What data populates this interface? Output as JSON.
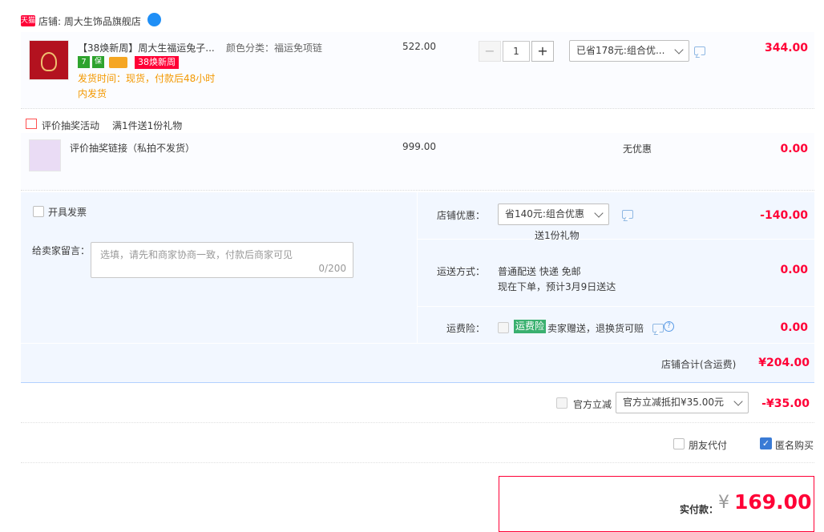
{
  "shop": {
    "badge": "天猫",
    "label": "店铺: 周大生饰品旗舰店",
    "wangwang": "(·)"
  },
  "item1": {
    "title": "【38焕新周】周大生福运兔子...",
    "sku": "颜色分类：福运免项链",
    "price": "522.00",
    "tag1": "7",
    "tag2": "保",
    "promo_badge": "38焕新周",
    "delivery_line1": "发货时间：现货，付款后48小时",
    "delivery_line2": "内发货",
    "quantity": "1",
    "discount_select": "已省178元:组合优...",
    "subtotal": "344.00",
    "minus": "−",
    "plus": "+"
  },
  "activity": {
    "label": "评价抽奖活动",
    "desc": "满1件送1份礼物"
  },
  "item2": {
    "title": "评价抽奖链接（私拍不发货）",
    "price": "999.00",
    "promo": "无优惠",
    "subtotal": "0.00"
  },
  "invoice": {
    "label": "开具发票"
  },
  "message": {
    "label": "给卖家留言：",
    "placeholder": "选填，请先和商家协商一致，付款后商家可见",
    "counter": "0/200"
  },
  "shop_discount": {
    "label": "店铺优惠：",
    "select": "省140元:组合优惠",
    "gift": "送1份礼物",
    "amount": "-140.00"
  },
  "shipping": {
    "label": "运送方式：",
    "method": "普通配送 快递 免邮",
    "eta": "现在下单，预计3月9日送达",
    "amount": "0.00"
  },
  "insurance": {
    "label": "运费险：",
    "badge": "运费险",
    "desc": "卖家赠送，退换货可赔",
    "amount": "0.00"
  },
  "shop_total": {
    "label": "店铺合计(含运费)",
    "amount": "¥204.00"
  },
  "official": {
    "label": "官方立减",
    "select": "官方立减抵扣¥35.00元",
    "amount": "-¥35.00"
  },
  "options": {
    "friend_pay": "朋友代付",
    "anonymous": "匿名购买"
  },
  "payment": {
    "label": "实付款：",
    "currency": "¥",
    "amount": "169.00"
  },
  "colors": {
    "accent_red": "#ff0036",
    "panel_bg": "#f2f7ff",
    "row_bg": "#fbfcff",
    "border_blue": "#b2d1ff"
  }
}
